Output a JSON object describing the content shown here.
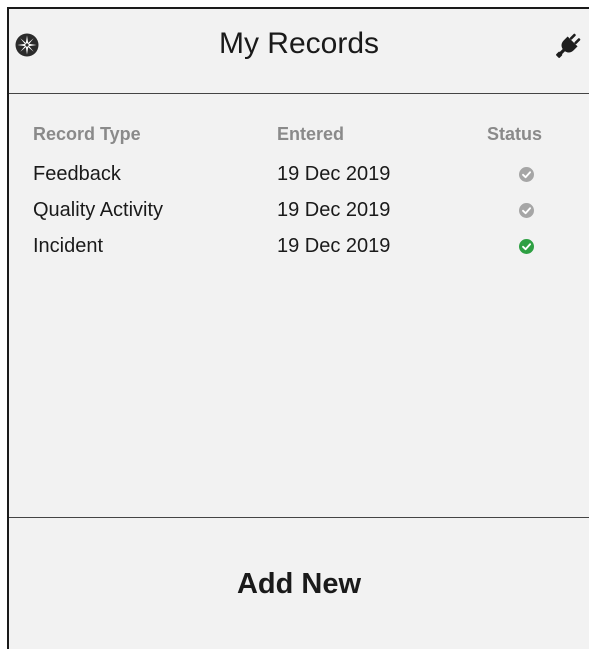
{
  "header": {
    "title": "My Records",
    "left_icon": "compass-icon",
    "right_icon": "plug-icon"
  },
  "table": {
    "columns": [
      "Record Type",
      "Entered",
      "Status"
    ],
    "rows": [
      {
        "type": "Feedback",
        "entered": "19 Dec 2019",
        "status": "pending"
      },
      {
        "type": "Quality Activity",
        "entered": "19 Dec 2019",
        "status": "pending"
      },
      {
        "type": "Incident",
        "entered": "19 Dec 2019",
        "status": "complete"
      }
    ]
  },
  "footer": {
    "add_label": "Add New"
  },
  "colors": {
    "status_pending": "#a6a6a6",
    "status_complete": "#2ea043"
  }
}
